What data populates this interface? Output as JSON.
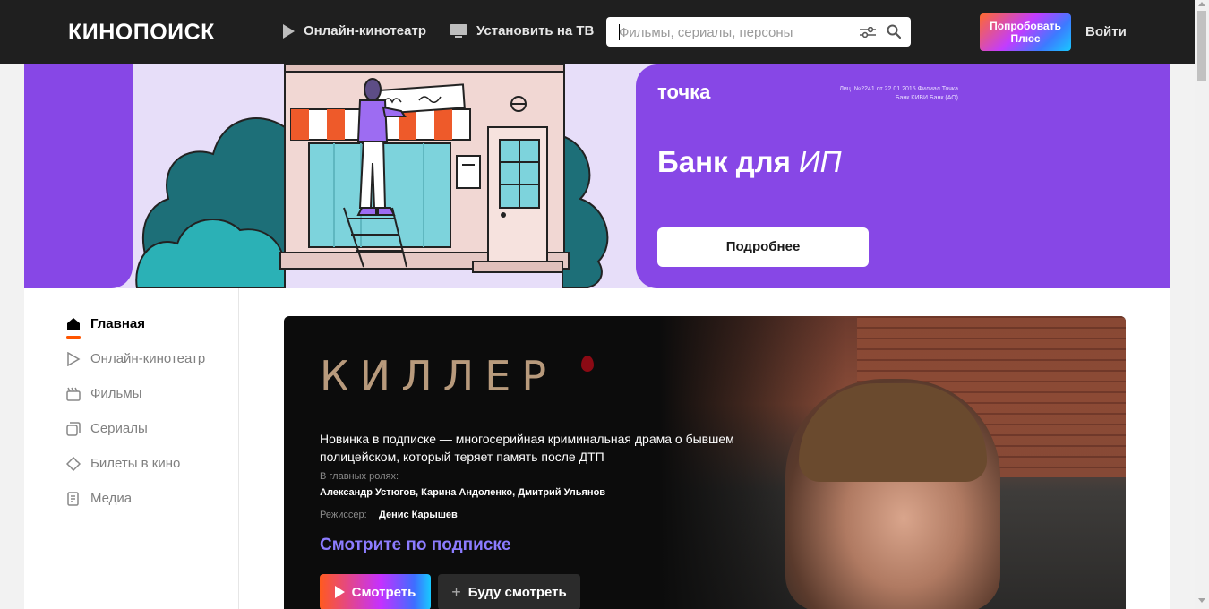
{
  "header": {
    "logo": "КИНОПОИСК",
    "nav": [
      {
        "label": "Онлайн-кинотеатр",
        "icon": "play-icon"
      },
      {
        "label": "Установить на ТВ",
        "icon": "tv-icon"
      }
    ],
    "search_placeholder": "Фильмы, сериалы, персоны",
    "plus_button": "Попробовать Плюс",
    "login": "Войти"
  },
  "banner": {
    "bank_logo": "точка",
    "license": "Лиц. №2241 от 22.01.2015 Филиал Точка Банк КИВИ Банк (АО)",
    "title_main": "Банк для ",
    "title_accent": "ИП",
    "button": "Подробнее",
    "colors": {
      "bg": "#e7def9",
      "accent": "#8747e6"
    }
  },
  "sidebar": {
    "items": [
      {
        "label": "Главная",
        "icon": "home-icon",
        "active": true
      },
      {
        "label": "Онлайн-кинотеатр",
        "icon": "play-outline-icon"
      },
      {
        "label": "Фильмы",
        "icon": "clapperboard-icon"
      },
      {
        "label": "Сериалы",
        "icon": "series-icon"
      },
      {
        "label": "Билеты в кино",
        "icon": "ticket-icon"
      },
      {
        "label": "Медиа",
        "icon": "media-icon"
      }
    ],
    "active_color": "#ff5500"
  },
  "feature": {
    "title": "КИЛЛЕР",
    "description": "Новинка в подписке — многосерийная криминальная драма о бывшем полицейском, который теряет память после ДТП",
    "cast_label": "В главных ролях:",
    "cast": "Александр Устюгов, Карина Андоленко, Дмитрий Ульянов",
    "director_label": "Режиссер:",
    "director": "Денис Карышев",
    "cta": "Смотрите по подписке",
    "watch_button": "Смотреть",
    "later_button": "Буду смотреть"
  }
}
